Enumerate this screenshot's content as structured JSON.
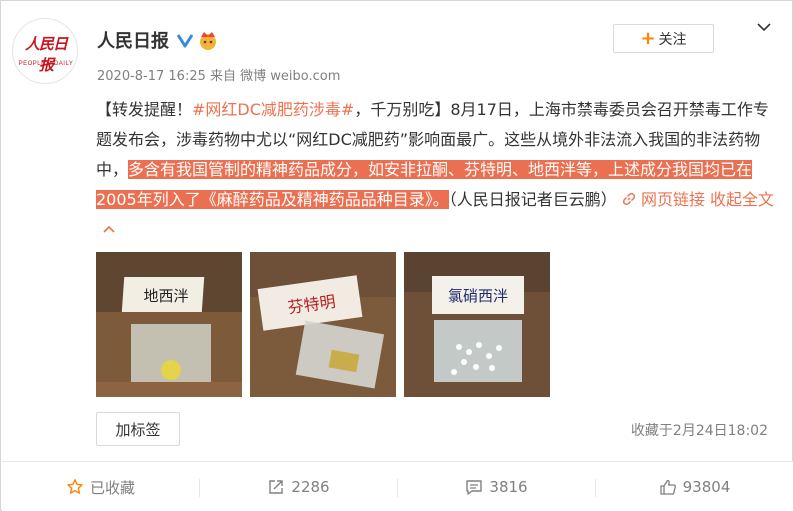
{
  "post": {
    "author": "人民日报",
    "logo_cn": "人民日报",
    "logo_en": "PEOPLE'S DAILY",
    "meta": "2020-8-17 16:25 来自 微博 weibo.com",
    "follow_label": "关注",
    "follow_plus": "+",
    "content": {
      "prefix": "【转发提醒！",
      "hashtag": "#网红DC减肥药涉毒#",
      "part1": "，千万别吃】8月17日，上海市禁毒委员会召开禁毒工作专题发布会，涉毒药物中尤以“网红DC减肥药”影响面最广。这些从境外非法流入我国的非法药物中，",
      "highlight": "多含有我国管制的精神药品成分，如安非拉酮、芬特明、地西泮等，上述成分我国均已在2005年列入了《麻醉药品及精神药品品种目录》。",
      "suffix": "（人民日报记者巨云鹏）",
      "weblink": "网页链接",
      "collapse": "收起全文"
    },
    "images": [
      {
        "label": "地西泮"
      },
      {
        "label": "芬特明"
      },
      {
        "label": "氯硝西泮"
      }
    ],
    "tag_button": "加标签",
    "collect_time": "收藏于2月24日18:02"
  },
  "actions": {
    "favorite": "已收藏",
    "repost": "2286",
    "comment": "3816",
    "like": "93804"
  },
  "colors": {
    "highlight": "#ea7051",
    "link": "#eb7350",
    "accent": "#ff8200"
  }
}
